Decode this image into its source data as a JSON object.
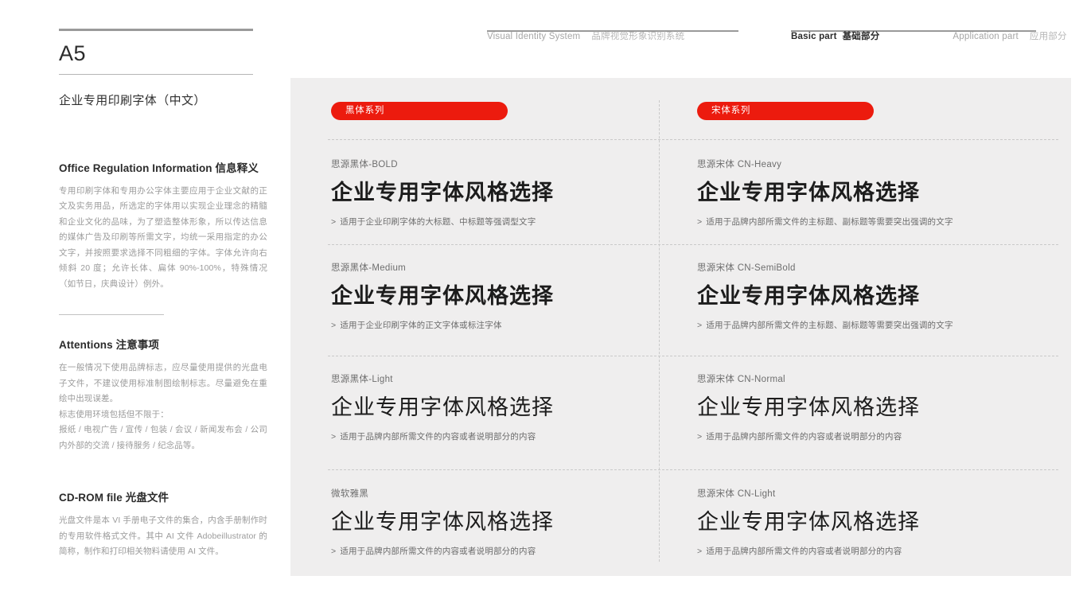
{
  "page": {
    "code": "A5",
    "section_title": "企业专用印刷字体（中文）"
  },
  "header": {
    "system_en": "Visual Identity System",
    "system_cn": "品牌视觉形象识别系统",
    "basic_en": "Basic part",
    "basic_cn": "基础部分",
    "application_en": "Application part",
    "application_cn": "应用部分"
  },
  "sidebar": {
    "blocks": [
      {
        "heading_en": "Office Regulation Information",
        "heading_cn": "信息释义",
        "body": "专用印刷字体和专用办公字体主要应用于企业文献的正文及实务用品，所选定的字体用以实现企业理念的精髓和企业文化的品味，为了塑造整体形象，所以传达信息的媒体广告及印刷等所需文字，均统一采用指定的办公文字，并按照要求选择不同粗细的字体。字体允许向右倾斜 20 度；允许长体、扁体 90%-100%，特殊情况（如节日，庆典设计）例外。"
      },
      {
        "heading_en": "Attentions",
        "heading_cn": "注意事项",
        "body_lines": [
          "在一般情况下使用品牌标志，应尽量使用提供的光盘电子文件，不建议使用标准制图绘制标志。尽量避免在重绘中出现误差。",
          "标志使用环境包括但不限于：",
          "报纸 / 电视广告 / 宣传 / 包装 / 会议 / 新闻发布会 / 公司内外部的交流 / 接待服务 / 纪念品等。"
        ]
      },
      {
        "heading_en": "CD-ROM file",
        "heading_cn": "光盘文件",
        "body": "光盘文件是本 VI 手册电子文件的集合，内含手册制作时的专用软件格式文件。其中 AI 文件 Adobeillustrator 的简称，制作和打印相关物料请使用 AI 文件。"
      }
    ]
  },
  "panel": {
    "background": "#efeeee",
    "accent": "#ec1b0e",
    "pill_left": "黑体系列",
    "pill_right": "宋体系列",
    "columns": [
      {
        "id": "hei",
        "specimens": [
          {
            "name": "思源黑体-BOLD",
            "sample": "企业专用字体风格选择",
            "note": "适用于企业印刷字体的大标题、中标题等强调型文字",
            "caret": ">"
          },
          {
            "name": "思源黑体-Medium",
            "sample": "企业专用字体风格选择",
            "note": "适用于企业印刷字体的正文字体或标注字体",
            "caret": ">"
          },
          {
            "name": "思源黑体-Light",
            "sample": "企业专用字体风格选择",
            "note": "适用于品牌内部所需文件的内容或者说明部分的内容",
            "caret": ">"
          },
          {
            "name": "微软雅黑",
            "sample": "企业专用字体风格选择",
            "note": "适用于品牌内部所需文件的内容或者说明部分的内容",
            "caret": ">"
          }
        ]
      },
      {
        "id": "song",
        "specimens": [
          {
            "name": "思源宋体 CN-Heavy",
            "sample": "企业专用字体风格选择",
            "note": "适用于品牌内部所需文件的主标题、副标题等需要突出强调的文字",
            "caret": ">"
          },
          {
            "name": "思源宋体 CN-SemiBold",
            "sample": "企业专用字体风格选择",
            "note": "适用于品牌内部所需文件的主标题、副标题等需要突出强调的文字",
            "caret": ">"
          },
          {
            "name": "思源宋体 CN-Normal",
            "sample": "企业专用字体风格选择",
            "note": "适用于品牌内部所需文件的内容或者说明部分的内容",
            "caret": ">"
          },
          {
            "name": "思源宋体 CN-Light",
            "sample": "企业专用字体风格选择",
            "note": "适用于品牌内部所需文件的内容或者说明部分的内容",
            "caret": ">"
          }
        ]
      }
    ]
  }
}
